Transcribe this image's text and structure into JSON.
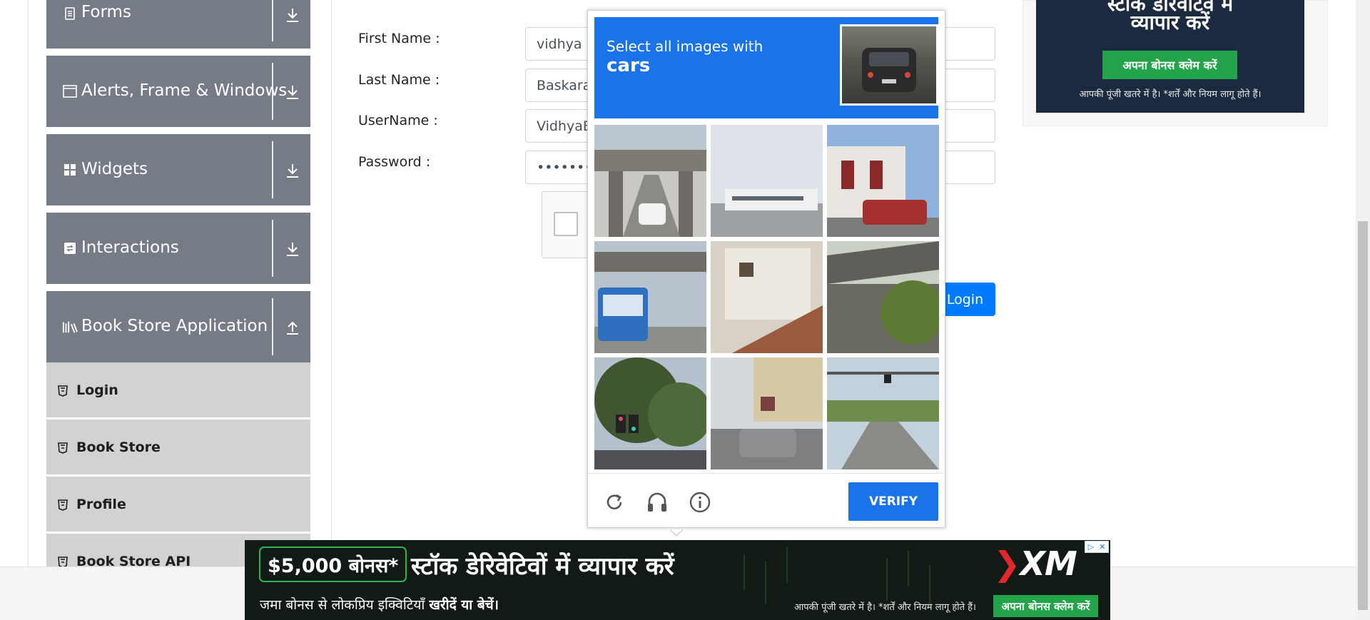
{
  "sidebar": {
    "groups": [
      {
        "title": "Forms",
        "icon": "forms-icon",
        "expanded": false
      },
      {
        "title": "Alerts, Frame & Windows",
        "icon": "window-icon",
        "expanded": false
      },
      {
        "title": "Widgets",
        "icon": "widgets-icon",
        "expanded": false
      },
      {
        "title": "Interactions",
        "icon": "interactions-icon",
        "expanded": false
      },
      {
        "title": "Book Store Application",
        "icon": "books-icon",
        "expanded": true
      }
    ],
    "bookstore_items": [
      {
        "label": "Login"
      },
      {
        "label": "Book Store"
      },
      {
        "label": "Profile"
      },
      {
        "label": "Book Store API"
      }
    ]
  },
  "form": {
    "first_name_label": "First Name :",
    "first_name_value": "vidhya",
    "last_name_label": "Last Name :",
    "last_name_value": "Baskaran",
    "username_label": "UserName :",
    "username_value": "VidhyaB",
    "password_label": "Password :",
    "password_value": "••••••••••",
    "login_button": "Login"
  },
  "captcha": {
    "instruction": "Select all images with",
    "target": "cars",
    "verify_label": "VERIFY",
    "tiles": [
      "bridge-road-with-white-car",
      "building-against-sky",
      "red-car-near-house",
      "bus-under-bridge",
      "white-house-stairs",
      "overpass-with-trees",
      "trees-traffic-light",
      "street-with-cars",
      "road-intersection"
    ],
    "footer_icons": [
      "reload-icon",
      "audio-icon",
      "info-icon"
    ]
  },
  "right_ad": {
    "line1": "स्टॉक डेरिवेटिव में",
    "line2": "व्यापार करें",
    "cta": "अपना बोनस क्लेम करें",
    "disclaimer": "आपकी पूंजी खतरे में है। *शर्तें और नियम लागू होते हैं।"
  },
  "bottom_ad": {
    "bonus": "$5,000 बोनस*",
    "headline": "स्टॉक डेरिवेटिवों में व्यापार करें",
    "subline_plain": "जमा बोनस से लोकप्रिय इक्विटियाँ",
    "subline_bold": "खरीदें या बेचें।",
    "brand": "XM",
    "disclaimer": "आपकी पूंजी खतरे में है। *शर्तें और नियम लागू होते हैं।",
    "cta": "अपना बोनस क्लेम करें"
  },
  "colors": {
    "sidebar_group": "#767c86",
    "sidebar_sub": "#d2d2d2",
    "captcha_blue": "#1a73e8",
    "login_blue": "#007bff",
    "ad_green": "#23a34a"
  }
}
